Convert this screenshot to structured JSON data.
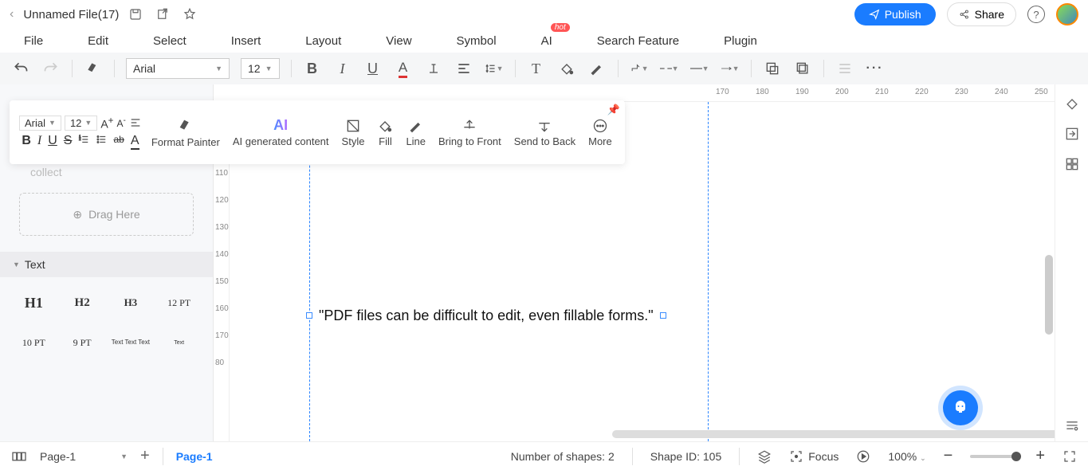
{
  "title": {
    "filename": "Unnamed File(17)",
    "publish": "Publish",
    "share": "Share"
  },
  "menu": {
    "file": "File",
    "edit": "Edit",
    "select": "Select",
    "insert": "Insert",
    "layout": "Layout",
    "view": "View",
    "symbol": "Symbol",
    "ai": "AI",
    "ai_badge": "hot",
    "search": "Search Feature",
    "plugin": "Plugin"
  },
  "toolbar": {
    "font": "Arial",
    "size": "12"
  },
  "floatbar": {
    "font": "Arial",
    "size": "12",
    "format_painter": "Format Painter",
    "ai": "AI generated content",
    "ai_short": "AI",
    "style": "Style",
    "fill": "Fill",
    "line": "Line",
    "front": "Bring to Front",
    "back": "Send to Back",
    "more": "More"
  },
  "left": {
    "collect": "collect",
    "draghere": "Drag Here",
    "text": "Text",
    "h1": "H1",
    "h2": "H2",
    "h3": "H3",
    "pt12": "12 PT",
    "pt10": "10 PT",
    "pt9": "9 PT",
    "multi": "Text\nText\nText",
    "tiny": "Text"
  },
  "canvas": {
    "text": "\"PDF files can be difficult to edit, even fillable forms.\""
  },
  "ruler_h": [
    "170",
    "180",
    "190",
    "200",
    "210",
    "220",
    "230",
    "240",
    "250"
  ],
  "ruler_v": [
    "110",
    "120",
    "130",
    "140",
    "150",
    "160",
    "170",
    "80"
  ],
  "status": {
    "page_sel": "Page-1",
    "page_tab": "Page-1",
    "shapes": "Number of shapes: 2",
    "shape_id": "Shape ID: 105",
    "focus": "Focus",
    "zoom": "100%"
  }
}
